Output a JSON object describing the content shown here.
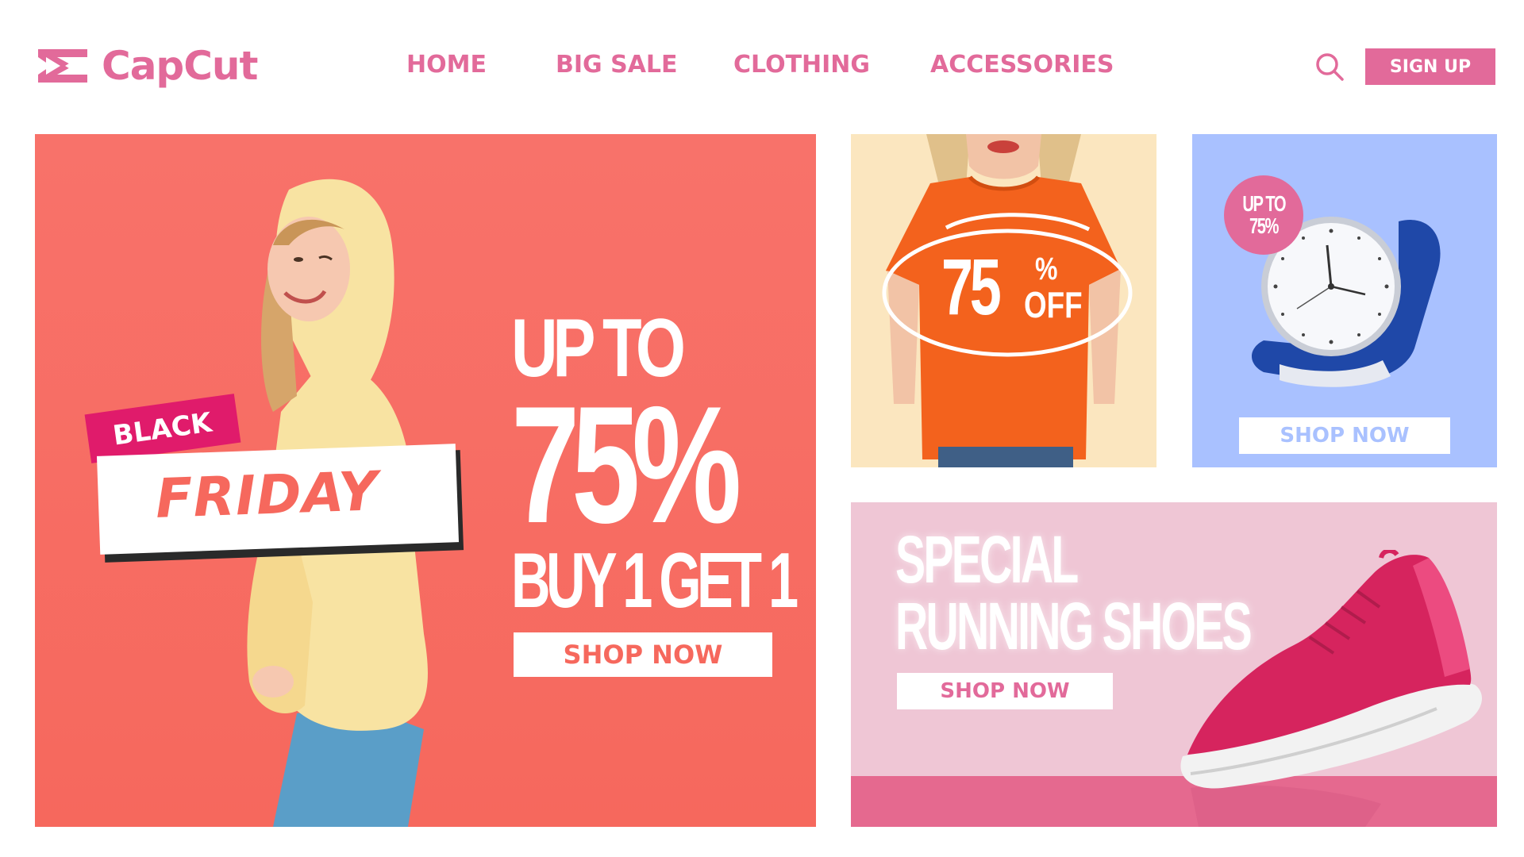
{
  "brand": {
    "name": "CapCut",
    "color": "#e26a9a"
  },
  "nav": {
    "items": [
      {
        "label": "HOME"
      },
      {
        "label": "BIG SALE"
      },
      {
        "label": "CLOTHING"
      },
      {
        "label": "ACCESSORIES"
      }
    ],
    "search_icon": "search-icon",
    "signup_label": "SIGN UP"
  },
  "hero": {
    "background": "#f6685d",
    "badge_top": "BLACK",
    "badge_main": "FRIDAY",
    "line1": "UP TO",
    "line2": "75%",
    "line3": "BUY 1 GET 1",
    "cta": "SHOP NOW"
  },
  "tile_shirt": {
    "background": "#fbe6bf",
    "number": "75",
    "percent": "%",
    "off": "OFF"
  },
  "tile_watch": {
    "background": "#a9c1ff",
    "badge_line1": "UP TO",
    "badge_line2": "75%",
    "cta": "SHOP NOW"
  },
  "tile_shoes": {
    "background": "#efc6d5",
    "strip_color": "#e5698f",
    "title_line1": "SPECIAL",
    "title_line2": "RUNNING SHOES",
    "cta": "SHOP NOW"
  }
}
